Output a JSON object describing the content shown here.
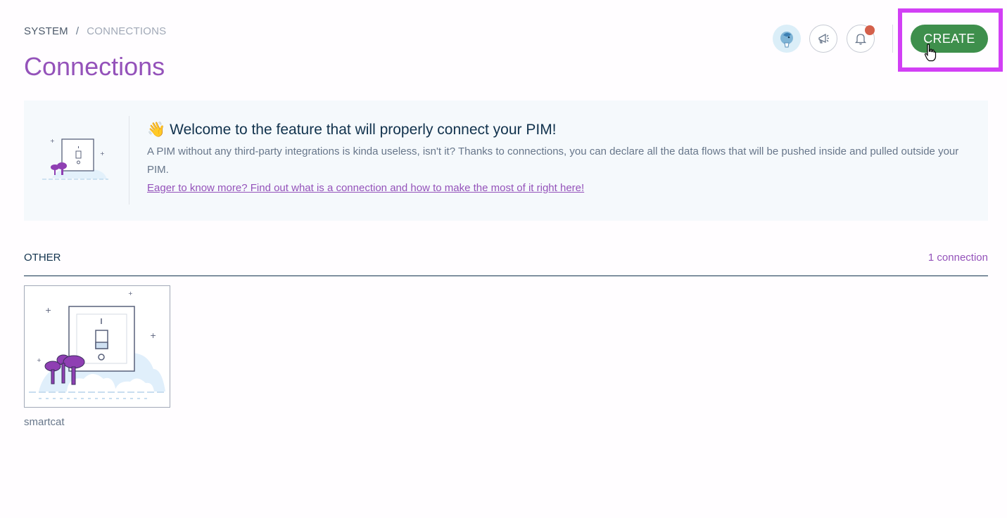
{
  "breadcrumb": {
    "items": [
      "SYSTEM",
      "CONNECTIONS"
    ],
    "separator": "/"
  },
  "page": {
    "title": "Connections"
  },
  "header": {
    "create_label": "CREATE",
    "icons": [
      "avatar-icon",
      "announcement-icon",
      "bell-icon"
    ],
    "notification_badge_color": "#d4604b",
    "highlight_color": "#d23ff5",
    "create_button_color": "#3e8f4c"
  },
  "helper": {
    "emoji": "👋",
    "title": "Welcome to the feature that will properly connect your PIM!",
    "text": "A PIM without any third-party integrations is kinda useless, isn't it? Thanks to connections, you can declare all the data flows that will be pushed inside and pulled outside your PIM.",
    "link_text": "Eager to know more? Find out what is a connection and how to make the most of it right here!"
  },
  "sections": [
    {
      "title": "OTHER",
      "count_label": "1 connection",
      "connections": [
        {
          "label": "smartcat",
          "image_icon": "light-switch-illustration"
        }
      ]
    }
  ],
  "colors": {
    "accent_purple": "#9452ba",
    "text_dark": "#11324d",
    "text_grey": "#67768a"
  }
}
